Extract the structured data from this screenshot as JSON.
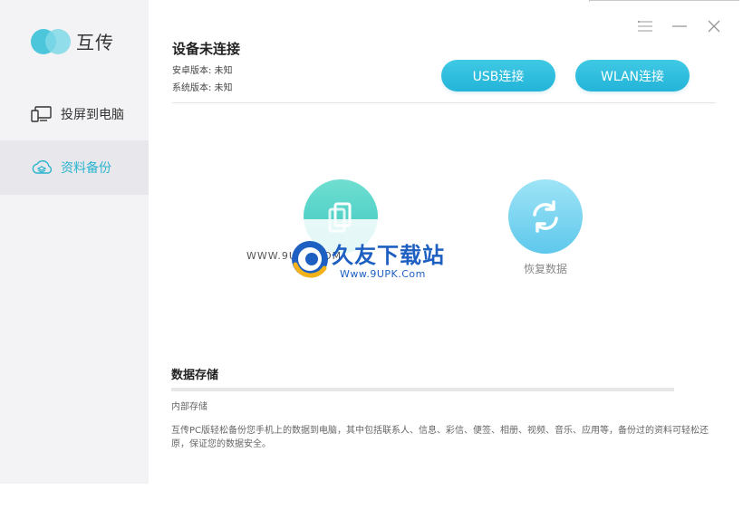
{
  "app": {
    "name": "互传"
  },
  "sidebar": {
    "items": [
      {
        "label": "投屏到电脑",
        "icon": "monitor-phone-icon",
        "active": false
      },
      {
        "label": "资料备份",
        "icon": "cloud-backup-icon",
        "active": true
      }
    ]
  },
  "window_controls": {
    "menu": "menu-icon",
    "minimize": "minimize-icon",
    "close": "close-icon"
  },
  "device": {
    "title": "设备未连接",
    "android_version": "安卓版本: 未知",
    "system_version": "系统版本: 未知"
  },
  "buttons": {
    "usb": "USB连接",
    "wlan": "WLAN连接"
  },
  "actions": {
    "restore_label": "恢复数据"
  },
  "watermark": {
    "url_left": "WWW.9UPK.COM",
    "title": "久友下载站",
    "subtitle": "Www.9UPK.Com"
  },
  "storage": {
    "title": "数据存储",
    "label": "内部存储",
    "used_fraction": 0,
    "description": "互传PC版轻松备份您手机上的数据到电脑，其中包括联系人、信息、彩信、便签、相册、视频、音乐、应用等，备份过的资料可轻松还原，保证您的数据安全。"
  },
  "colors": {
    "accent": "#2bb4cf",
    "sidebar_bg": "#f3f3f5",
    "active_bg": "#e8e8ec",
    "watermark": "#1e5fc2"
  }
}
